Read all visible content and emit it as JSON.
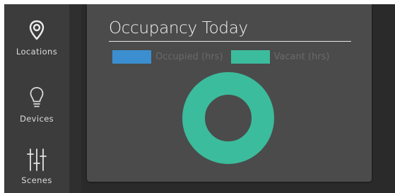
{
  "sidebar": {
    "items": [
      {
        "label": "Locations",
        "icon": "location-pin-icon"
      },
      {
        "label": "Devices",
        "icon": "lightbulb-icon"
      },
      {
        "label": "Scenes",
        "icon": "sliders-icon"
      }
    ]
  },
  "panel": {
    "title": "Occupancy Today"
  },
  "colors": {
    "occupied": "#3b8fd0",
    "vacant": "#3bbc9c",
    "panel_bg": "#4b4b4b",
    "sidebar_bg": "#3c3c3c"
  },
  "chart_data": {
    "type": "pie",
    "title": "Occupancy Today",
    "legend_position": "top",
    "categories": [
      "Occupied (hrs)",
      "Vacant (hrs)"
    ],
    "values": [
      0,
      1
    ],
    "series": [
      {
        "name": "Occupied (hrs)",
        "color": "#3b8fd0"
      },
      {
        "name": "Vacant (hrs)",
        "color": "#3bbc9c"
      }
    ]
  }
}
